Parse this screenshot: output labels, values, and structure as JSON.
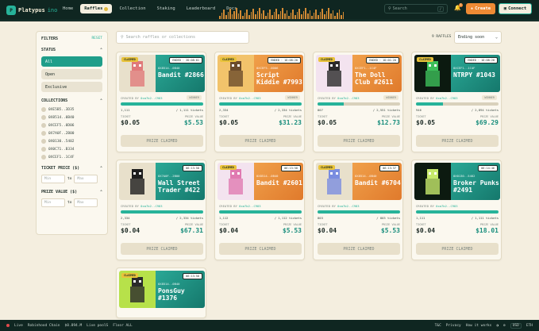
{
  "header": {
    "logo_text": "Platypus",
    "logo_suffix": "ino",
    "nav": [
      {
        "label": "Home"
      },
      {
        "label": "Raffles"
      },
      {
        "label": "Collection"
      },
      {
        "label": "Staking"
      },
      {
        "label": "Leaderboard"
      },
      {
        "label": "Docs"
      }
    ],
    "search_placeholder": "Search",
    "search_shortcut": "/",
    "bell_count": "1",
    "create_label": "Create",
    "connect_label": "Connect"
  },
  "sidebar": {
    "title": "FILTERS",
    "reset": "RESET",
    "status_title": "STATUS",
    "status_options": [
      "All",
      "Open",
      "Exclusive"
    ],
    "collections_title": "COLLECTIONS",
    "collections": [
      "0XE5B5..3D35",
      "0X8514..0B40",
      "0XCEF5..0D06",
      "0X7A0F..2B00",
      "0X0130..5402",
      "0X0C71..B334",
      "0XCEF1..1C4F"
    ],
    "ticket_title": "TICKET PRICE ($)",
    "prize_title": "PRIZE VALUE ($)",
    "min": "Min",
    "max": "Max",
    "to": "to"
  },
  "main": {
    "search_placeholder": "Search raffles or collections",
    "count_label": "9 RAFFLES",
    "sort_value": "Ending soon"
  },
  "cards": [
    {
      "collection": "0X8514..0B40",
      "title": "Bandit #2866",
      "status": "ENDED · 2D:08:01",
      "claimed": "CLAIMED",
      "creator": "0xa7b2..C983",
      "win": "WINNER",
      "sold": "1,111",
      "total": "/ 1,111 tickets",
      "progress": 1.0,
      "ticket": "$0.05",
      "prize": "$5.53",
      "button": "PRIZE CLAIMED"
    },
    {
      "collection": "0XCEF5..0D06",
      "title": "Script Kiddie #7993",
      "status": "ENDED · 1D:08:20",
      "claimed": "CLAIMED",
      "creator": "0xa7b2..C983",
      "win": "WINNER",
      "sold": "2,334",
      "total": "/ 2,334 tickets",
      "progress": 1.0,
      "ticket": "$0.05",
      "prize": "$31.23",
      "button": "PRIZE CLAIMED"
    },
    {
      "collection": "0XCEF1..1C4F",
      "title": "The Doll Club #2611",
      "status": "ENDED · 1D:01:20",
      "claimed": "CLAIMED",
      "creator": "0xa7b2..C983",
      "win": "WINNER",
      "sold": "807",
      "total": "/ 2,551 tickets",
      "progress": 0.32,
      "ticket": "$0.05",
      "prize": "$12.73",
      "button": "PRIZE CLAIMED"
    },
    {
      "collection": "0XCEF1..1C4F",
      "title": "NTRPY #1043",
      "status": "ENDED · 1D:08:20",
      "claimed": "CLAIMED",
      "creator": "0xa7b2..C983",
      "win": "WINNER",
      "sold": "946",
      "total": "/ 2,894 tickets",
      "progress": 0.33,
      "ticket": "$0.05",
      "prize": "$69.29",
      "button": "PRIZE CLAIMED"
    },
    {
      "collection": "0X7A0F..2B00",
      "title": "Wall Street Trader #422",
      "status": "06:13:58",
      "claimed": "",
      "creator": "0xa7b2..C983",
      "win": "",
      "sold": "2,334",
      "total": "/ 2,334 tickets",
      "progress": 1.0,
      "ticket": "$0.04",
      "prize": "$67.31",
      "button": "PRIZE CLAIMED"
    },
    {
      "collection": "0X8514..0B40",
      "title": "Bandit #2601",
      "status": "06:13:58",
      "claimed": "CLAIMED",
      "creator": "0xa7b2..C983",
      "win": "",
      "sold": "1,112",
      "total": "/ 1,112 tickets",
      "progress": 1.0,
      "ticket": "$0.04",
      "prize": "$5.53",
      "button": "PRIZE CLAIMED"
    },
    {
      "collection": "0X8514..0B40",
      "title": "Bandit #6704",
      "status": "06:13:37",
      "claimed": "CLAIMED",
      "creator": "0xa7b2..C983",
      "win": "",
      "sold": "803",
      "total": "/ 803 tickets",
      "progress": 1.0,
      "ticket": "$0.04",
      "prize": "$5.53",
      "button": "PRIZE CLAIMED"
    },
    {
      "collection": "0X0130..5402",
      "title": "Broker Punks #2491",
      "status": "06:14:46",
      "claimed": "",
      "creator": "0xa7b2..C983",
      "win": "",
      "sold": "1,111",
      "total": "/ 1,111 tickets",
      "progress": 1.0,
      "ticket": "$0.04",
      "prize": "$18.01",
      "button": "PRIZE CLAIMED"
    },
    {
      "collection": "0X8514..0B40",
      "title": "PonsGuy #1376",
      "status": "06:13:58",
      "claimed": "CLAIMED",
      "creator": "",
      "win": "",
      "sold": "",
      "total": "",
      "progress": 0,
      "ticket": "",
      "prize": "",
      "button": ""
    }
  ],
  "labels": {
    "created_by": "CREATED BY",
    "ticket": "TICKET",
    "prize_value": "PRIZE VALUE"
  },
  "footer": {
    "live": "Live",
    "chain": "Robinhood Chain",
    "price": "$0.894.M",
    "live_pool": "Live poolS",
    "floor": "Floor ALL",
    "links": [
      "T&C",
      "Privacy",
      "How it works"
    ],
    "currency": "USD",
    "currency2": "ETH"
  },
  "colors": {
    "accent": "#27b39a",
    "orange": "#ee8a34",
    "dark": "#0f2621",
    "cream": "#f4eedf"
  }
}
